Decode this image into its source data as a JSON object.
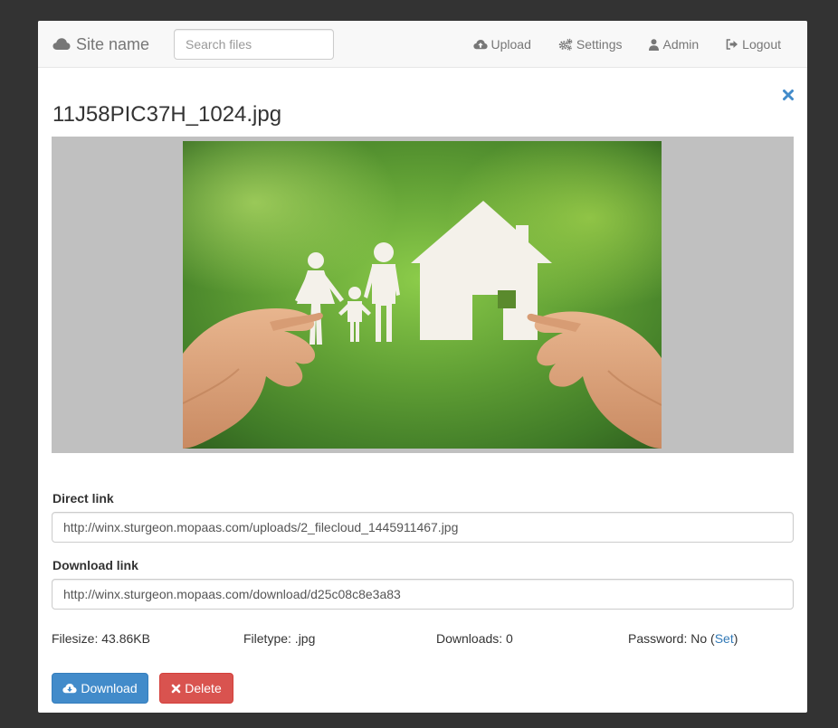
{
  "navbar": {
    "brand": "Site name",
    "brand_icon": "cloud-icon",
    "search_placeholder": "Search files",
    "items": [
      {
        "label": "Upload",
        "icon": "cloud-upload-icon"
      },
      {
        "label": "Settings",
        "icon": "gears-icon"
      },
      {
        "label": "Admin",
        "icon": "user-icon"
      },
      {
        "label": "Logout",
        "icon": "logout-icon"
      }
    ]
  },
  "file": {
    "name": "11J58PIC37H_1024.jpg",
    "direct_link_label": "Direct link",
    "direct_link": "http://winx.sturgeon.mopaas.com/uploads/2_filecloud_1445911467.jpg",
    "download_link_label": "Download link",
    "download_link": "http://winx.sturgeon.mopaas.com/download/d25c08c8e3a83",
    "filesize": "Filesize: 43.86KB",
    "filetype": "Filetype: .jpg",
    "downloads": "Downloads: 0",
    "password_prefix": "Password: No (",
    "password_set": "Set",
    "password_suffix": ")"
  },
  "actions": {
    "download": "Download",
    "delete": "Delete"
  },
  "colors": {
    "background": "#333333",
    "primary": "#428bca",
    "danger": "#d9534f",
    "link": "#337ab7",
    "preview_bg": "#c0c0c0"
  }
}
